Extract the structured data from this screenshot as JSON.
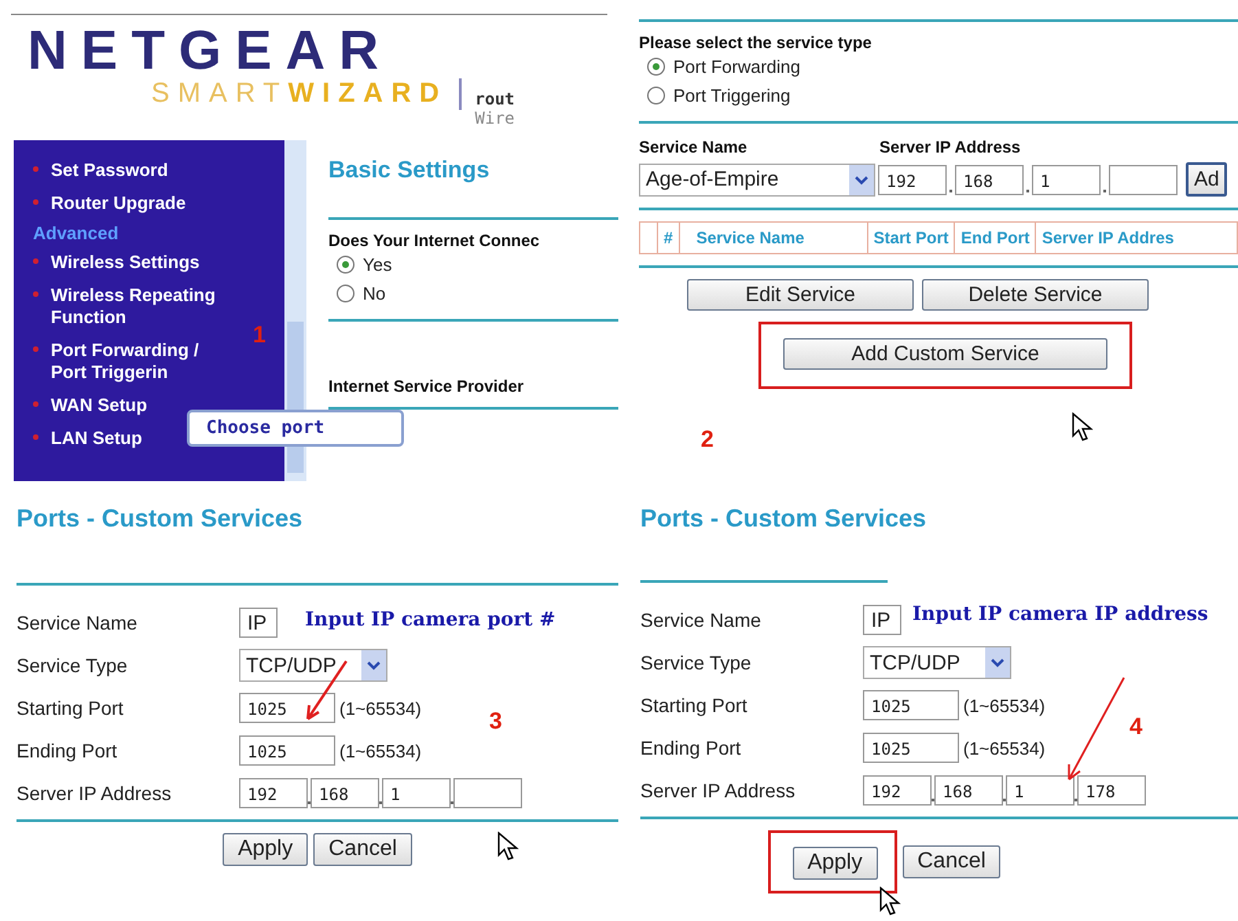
{
  "wizard": {
    "logo": "NETGEAR",
    "smart": "SMART",
    "wizard": "WIZARD",
    "tagline_1": "rout",
    "tagline_2": "Wire",
    "menu": [
      {
        "label": "Set Password",
        "kind": "item"
      },
      {
        "label": "Router Upgrade",
        "kind": "item"
      },
      {
        "label": "Advanced",
        "kind": "section"
      },
      {
        "label": "Wireless Settings",
        "kind": "item"
      },
      {
        "label": "Wireless Repeating Function",
        "kind": "item"
      },
      {
        "label": "Port Forwarding / Port Triggerin",
        "kind": "item"
      },
      {
        "label": "WAN Setup",
        "kind": "item"
      },
      {
        "label": "LAN Setup",
        "kind": "item"
      }
    ],
    "step": "1",
    "callout": "Choose port",
    "title": "Basic Settings",
    "question": "Does Your Internet Connec",
    "options": [
      {
        "label": "Yes",
        "selected": true
      },
      {
        "label": "No",
        "selected": false
      }
    ],
    "section_label": "Internet Service Provider"
  },
  "services": {
    "prompt": "Please select the service type",
    "types": [
      {
        "label": "Port Forwarding",
        "selected": true
      },
      {
        "label": "Port Triggering",
        "selected": false
      }
    ],
    "name_label": "Service Name",
    "ip_label": "Server IP Address",
    "service": "Age-of-Empire",
    "octets": [
      "192",
      "168",
      "1"
    ],
    "add_button": "Ad",
    "columns": [
      "#",
      "Service Name",
      "Start Port",
      "End Port",
      "Server IP Addres"
    ],
    "buttons": [
      {
        "label": "Edit Service",
        "highlighted": false
      },
      {
        "label": "Delete Service",
        "highlighted": false
      },
      {
        "label": "Add Custom Service",
        "highlighted": true
      }
    ],
    "step": "2"
  },
  "forms": [
    {
      "title": "Ports - Custom Services",
      "callout": "Input IP camera port #",
      "step": "3",
      "fields": [
        {
          "label": "Service Name",
          "kind": "text",
          "value": "IP"
        },
        {
          "label": "Service Type",
          "kind": "select",
          "value": "TCP/UDP"
        },
        {
          "label": "Starting Port",
          "kind": "port",
          "value": "1025",
          "hint": "(1~65534)"
        },
        {
          "label": "Ending Port",
          "kind": "port",
          "value": "1025",
          "hint": "(1~65534)"
        },
        {
          "label": "Server IP Address",
          "kind": "ip",
          "octets": [
            "192",
            "168",
            "1"
          ]
        }
      ],
      "buttons": [
        {
          "label": "Apply",
          "highlighted": false
        },
        {
          "label": "Cancel",
          "highlighted": false
        }
      ]
    },
    {
      "title": "Ports - Custom Services",
      "callout": "Input IP camera IP address",
      "step": "4",
      "fields": [
        {
          "label": "Service Name",
          "kind": "text",
          "value": "IP"
        },
        {
          "label": "Service Type",
          "kind": "select",
          "value": "TCP/UDP"
        },
        {
          "label": "Starting Port",
          "kind": "port",
          "value": "1025",
          "hint": "(1~65534)"
        },
        {
          "label": "Ending Port",
          "kind": "port",
          "value": "1025",
          "hint": "(1~65534)"
        },
        {
          "label": "Server IP Address",
          "kind": "ip",
          "octets": [
            "192",
            "168",
            "1",
            "178"
          ]
        }
      ],
      "buttons": [
        {
          "label": "Apply",
          "highlighted": true
        },
        {
          "label": "Cancel",
          "highlighted": false
        }
      ]
    }
  ]
}
